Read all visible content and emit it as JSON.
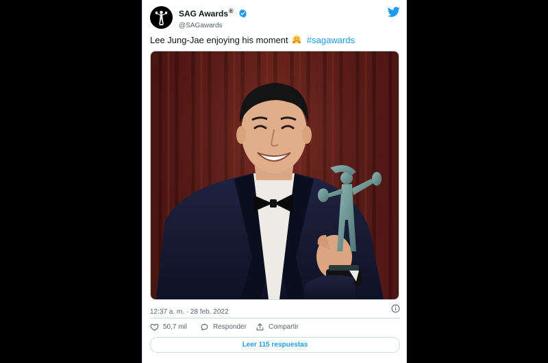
{
  "author": {
    "display_name": "SAG Awards",
    "registered_mark": "®",
    "handle": "@SAGawards"
  },
  "tweet": {
    "text": "Lee Jung-Jae enjoying his moment",
    "emoji": "hugging-face-emoji",
    "hashtag": "#sagawards",
    "timestamp": "12:37 a. m. · 28 feb. 2022"
  },
  "actions": {
    "likes": "50,7 mil",
    "reply_label": "Responder",
    "share_label": "Compartir",
    "read_replies_label": "Leer 115 respuestas"
  },
  "colors": {
    "accent": "#1d9bf0",
    "text": "#0f1419",
    "muted": "#536471",
    "border": "#cfd9de",
    "background": "#000000"
  },
  "icons": [
    "sag-actor-logo-icon",
    "verified-badge-icon",
    "twitter-bird-icon",
    "info-icon",
    "heart-icon",
    "comment-icon",
    "share-icon"
  ]
}
